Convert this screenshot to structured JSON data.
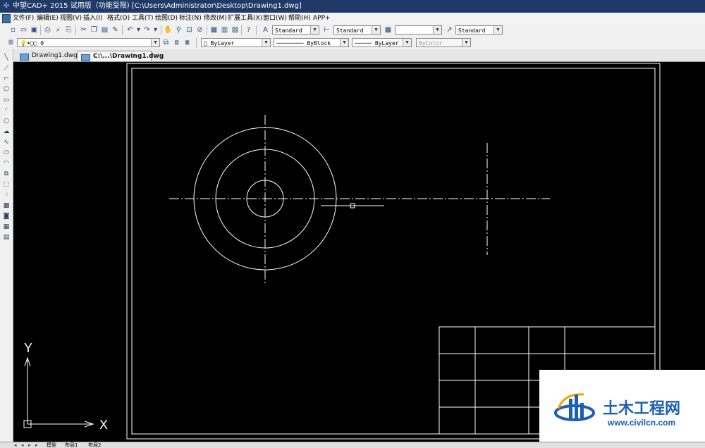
{
  "titlebar": {
    "app_title": "中望CAD+ 2015 试用版（功能受限）",
    "file_path": "- [C:\\Users\\Administrator\\Desktop\\Drawing1.dwg]"
  },
  "menu": {
    "items": [
      "文件(F)",
      "编辑(E)",
      "视图(V)",
      "插入(I)",
      "格式(O)",
      "工具(T)",
      "绘图(D)",
      "标注(N)",
      "修改(M)",
      "扩展工具(X)",
      "窗口(W)",
      "帮助(H)",
      "APP+"
    ]
  },
  "toolbar_styles": {
    "text_style": "Standard",
    "dim_style": "Standard",
    "table_style": "",
    "multileader_style": "Standard"
  },
  "layer_bar": {
    "layer": "0",
    "color": "ByLayer",
    "linetype": "ByBlock",
    "lineweight": "ByLayer",
    "plot_style": "ByColor"
  },
  "tabs": [
    {
      "label": "Drawing1.dwg"
    },
    {
      "label": "C:\\...\\Drawing1.dwg"
    }
  ],
  "ucs": {
    "x_label": "X",
    "y_label": "Y"
  },
  "layout_tabs": [
    "模型",
    "布局1",
    "布局2"
  ],
  "watermark": {
    "brand": "土木工程网",
    "url": "www.civilcn.com"
  },
  "colors": {
    "canvas_bg": "#000000",
    "lines": "#ffffff",
    "watermark_brand": "#1d5fb3",
    "watermark_accent": "#f0a500"
  }
}
